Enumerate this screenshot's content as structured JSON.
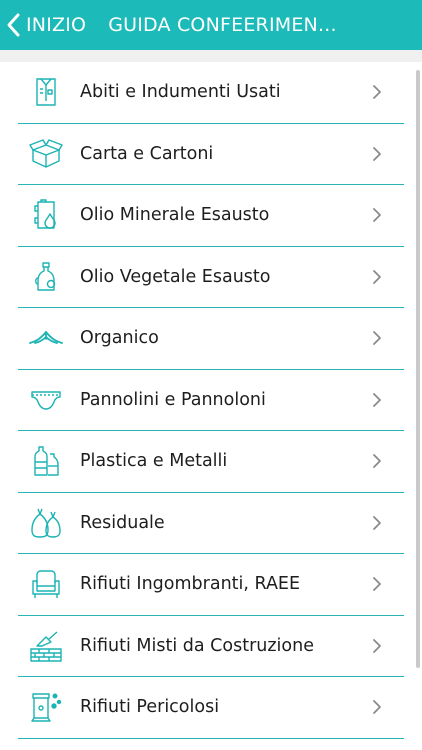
{
  "header": {
    "back_label": "INIZIO",
    "title": "GUIDA CONFEERIMEN..."
  },
  "items": [
    {
      "label": "Abiti e Indumenti Usati",
      "icon": "clothes-icon"
    },
    {
      "label": "Carta e Cartoni",
      "icon": "cardboard-box-icon"
    },
    {
      "label": "Olio Minerale Esausto",
      "icon": "oil-can-icon"
    },
    {
      "label": "Olio Vegetale Esausto",
      "icon": "oil-bottle-icon"
    },
    {
      "label": "Organico",
      "icon": "organic-icon"
    },
    {
      "label": "Pannolini e Pannoloni",
      "icon": "diaper-icon"
    },
    {
      "label": "Plastica e Metalli",
      "icon": "plastic-bottles-icon"
    },
    {
      "label": "Residuale",
      "icon": "trash-bags-icon"
    },
    {
      "label": "Rifiuti Ingombranti, RAEE",
      "icon": "armchair-icon"
    },
    {
      "label": "Rifiuti Misti da Costruzione",
      "icon": "bricks-trowel-icon"
    },
    {
      "label": "Rifiuti Pericolosi",
      "icon": "hazard-container-icon"
    }
  ],
  "colors": {
    "accent": "#1cbab9",
    "divider": "#25b6b5",
    "icon": "#1cb3b3",
    "chevron": "#8a8a8a"
  }
}
